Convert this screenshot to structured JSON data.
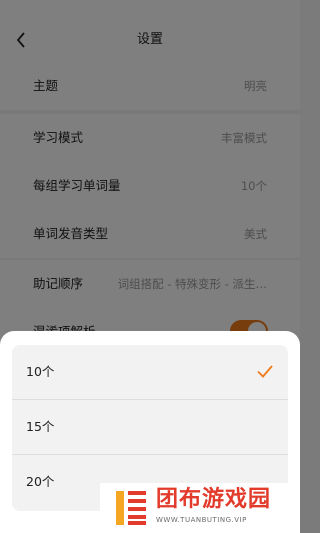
{
  "header": {
    "title": "设置",
    "back_icon": "chevron-left-icon"
  },
  "settings": {
    "theme": {
      "label": "主题",
      "value": "明亮"
    },
    "study_mode": {
      "label": "学习模式",
      "value": "丰富模式"
    },
    "words_per_group": {
      "label": "每组学习单词量",
      "value": "10个"
    },
    "pronunciation_type": {
      "label": "单词发音类型",
      "value": "美式"
    },
    "mnemonic_order": {
      "label": "助记顺序",
      "value": "词组搭配 - 特殊变形 - 派生…"
    },
    "confusion_analysis": {
      "label": "混淆项解析",
      "toggle_on": true
    }
  },
  "sheet": {
    "options": [
      {
        "label": "10个",
        "selected": true
      },
      {
        "label": "15个",
        "selected": false
      },
      {
        "label": "20个",
        "selected": false
      }
    ],
    "check_icon": "check-icon"
  },
  "watermark": {
    "name": "团布游戏园",
    "url": "WWW.TUANBUTING.VIP"
  },
  "colors": {
    "accent": "#f07a1a",
    "brand": "#e23a2b"
  }
}
